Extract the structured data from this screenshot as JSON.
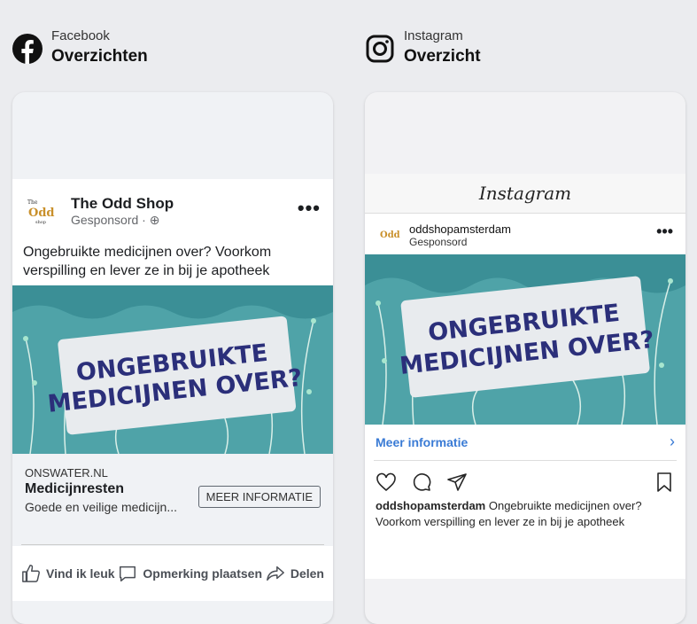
{
  "facebook": {
    "platform": "Facebook",
    "heading": "Overzichten",
    "page_name": "The Odd Shop",
    "sponsored": "Gesponsord · ",
    "primary_text": "Ongebruikte medicijnen over? Voorkom verspilling en lever ze in bij je apotheek",
    "image_text_line1": "ONGEBRUIKTE",
    "image_text_line2": "MEDICIJNEN OVER?",
    "domain": "ONSWATER.NL",
    "headline": "Medicijnresten",
    "description": "Goede en veilige medicijn...",
    "cta_label": "MEER INFORMATIE",
    "actions": {
      "like": "Vind ik leuk",
      "comment": "Opmerking plaatsen",
      "share": "Delen"
    }
  },
  "instagram": {
    "platform": "Instagram",
    "heading": "Overzicht",
    "brand": "Instagram",
    "username": "oddshopamsterdam",
    "sponsored": "Gesponsord",
    "image_text_line1": "ONGEBRUIKTE",
    "image_text_line2": "MEDICIJNEN OVER?",
    "cta_label": "Meer informatie",
    "caption_user": "oddshopamsterdam",
    "caption_text": " Ongebruikte medicijnen over? Voorkom verspilling en lever ze in bij je apotheek"
  },
  "colors": {
    "ad_teal": "#4fa3a8",
    "ad_text": "#2b2f7a",
    "ig_blue": "#3a7bd5"
  }
}
